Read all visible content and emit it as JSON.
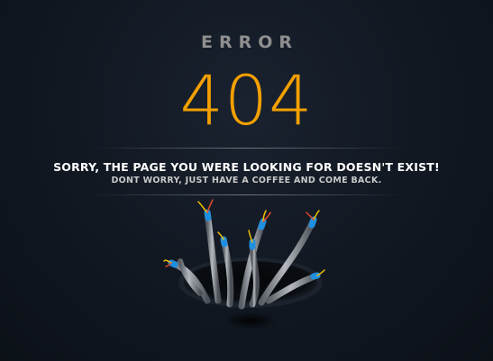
{
  "error": {
    "label": "ERROR",
    "code": "404"
  },
  "message": {
    "headline": "SORRY, THE PAGE YOU WERE LOOKING FOR DOESN'T EXIST!",
    "subline": "DONT WORRY, JUST HAVE A COFFEE AND COME BACK."
  },
  "colors": {
    "background": "#0e141c",
    "accent": "#f3a000",
    "headline": "#ffffff",
    "label": "#8f8f8f"
  },
  "illustration": {
    "icon": "cables-in-hole-illustration"
  }
}
